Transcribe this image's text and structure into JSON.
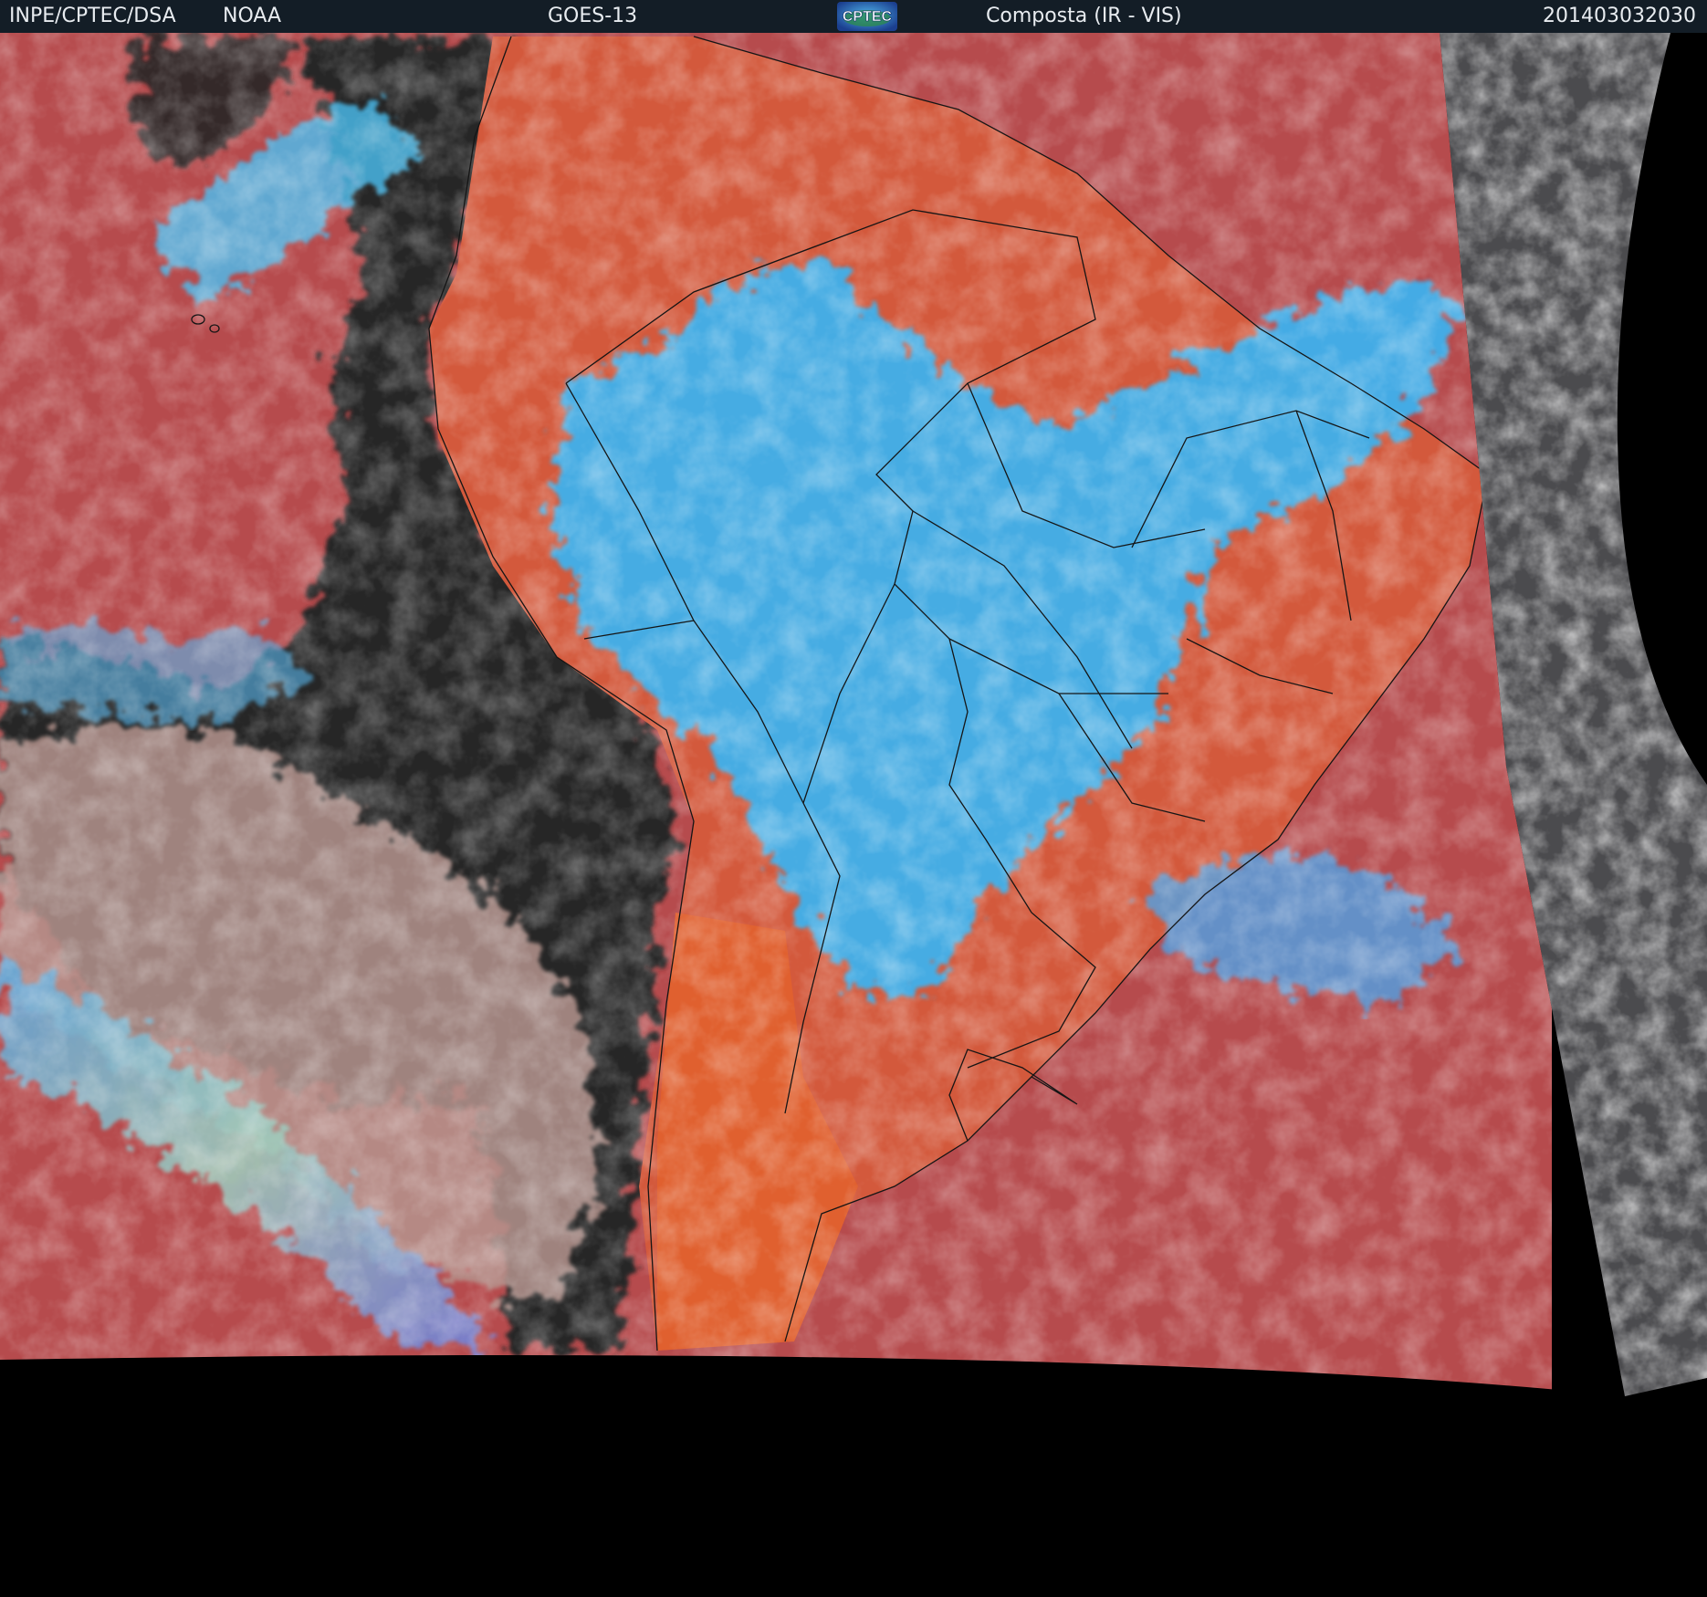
{
  "header": {
    "agency": "INPE/CPTEC/DSA",
    "partner": "NOAA",
    "satellite": "GOES-13",
    "logo_text": "CPTEC",
    "product": "Composta (IR - VIS)",
    "timestamp": "201403032030"
  },
  "colors": {
    "header_bg": "#131d26",
    "header_text": "#e8ecf0",
    "clear_ocean": "#b84a4c",
    "clear_land": "#d9583a",
    "high_cloud": "#3fb0f0",
    "low_cloud_dark": "#2a2a2c",
    "stratocumulus": "#b89a90",
    "vis_gray_disk": "#4e4e50",
    "no_data": "#000000",
    "borders": "#151515"
  }
}
